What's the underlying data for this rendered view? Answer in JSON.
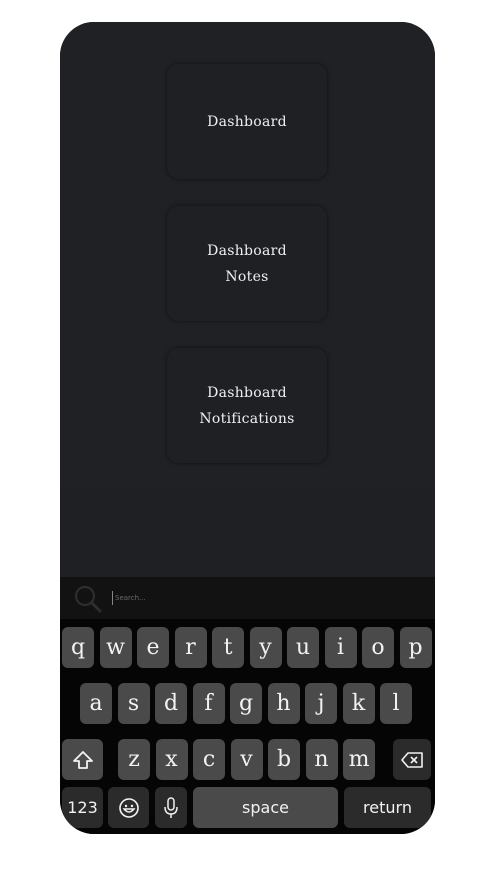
{
  "cards": [
    {
      "lines": [
        "Dashboard"
      ]
    },
    {
      "lines": [
        "Dashboard",
        "Notes"
      ]
    },
    {
      "lines": [
        "Dashboard",
        "Notifications"
      ]
    }
  ],
  "search": {
    "placeholder": "Search..."
  },
  "keyboard": {
    "row1": [
      "q",
      "w",
      "e",
      "r",
      "t",
      "y",
      "u",
      "i",
      "o",
      "p"
    ],
    "row2": [
      "a",
      "s",
      "d",
      "f",
      "g",
      "h",
      "j",
      "k",
      "l"
    ],
    "row3": [
      "z",
      "x",
      "c",
      "v",
      "b",
      "n",
      "m"
    ],
    "numbers_label": "123",
    "space_label": "space",
    "return_label": "return"
  },
  "icons": {
    "search": "search-icon",
    "shift": "shift-icon",
    "backspace": "backspace-icon",
    "emoji": "emoji-icon",
    "mic": "microphone-icon"
  },
  "colors": {
    "background": "#1f2024",
    "key": "#4a4a4a",
    "key_dark": "#2b2b2b",
    "keyboard_bg": "#050505",
    "text": "#f0f0f0"
  }
}
